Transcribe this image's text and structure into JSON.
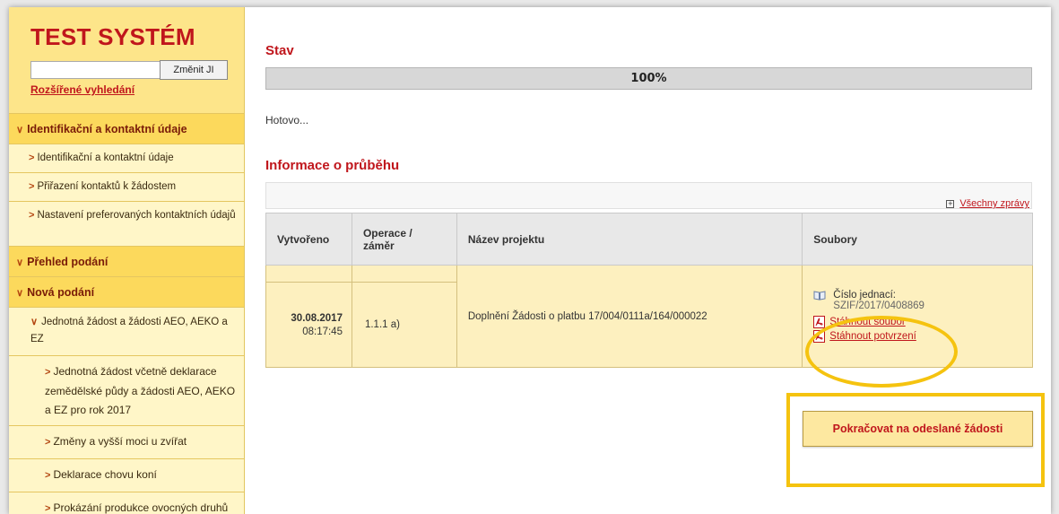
{
  "sidebar": {
    "brand": "TEST SYSTÉM",
    "search_value": "",
    "search_button": "Změnit JI",
    "advanced_search": "Rozšířené vyhledání",
    "items": [
      {
        "label": "Identifikační a kontaktní údaje",
        "kind": "head",
        "icon": "chevron-down"
      },
      {
        "label": "Identifikační a kontaktní údaje",
        "kind": "sub",
        "icon": "chevron-right"
      },
      {
        "label": "Přiřazení kontaktů k žádostem",
        "kind": "sub",
        "icon": "chevron-right"
      },
      {
        "label": "Nastavení preferovaných kontaktních údajů",
        "kind": "sub",
        "icon": "chevron-right"
      },
      {
        "label": "Přehled podání",
        "kind": "head",
        "icon": "chevron-down"
      },
      {
        "label": "Nová podání",
        "kind": "head",
        "icon": "chevron-down"
      },
      {
        "label": "Jednotná žádost a žádosti AEO, AEKO a EZ",
        "kind": "sub",
        "icon": "chevron-down"
      },
      {
        "label": "Jednotná žádost včetně deklarace zemědělské půdy a žádosti AEO, AEKO a EZ pro rok 2017",
        "kind": "sub3",
        "icon": "chevron-right"
      },
      {
        "label": "Změny a vyšší moci u zvířat",
        "kind": "sub3",
        "icon": "chevron-right"
      },
      {
        "label": "Deklarace chovu koní",
        "kind": "sub3",
        "icon": "chevron-right"
      },
      {
        "label": "Prokázání produkce ovocných druhů",
        "kind": "sub3",
        "icon": "chevron-right"
      }
    ]
  },
  "main": {
    "stav_title": "Stav",
    "progress": {
      "percent": 100,
      "label": "100%"
    },
    "status_text": "Hotovo...",
    "info_title": "Informace o průběhu",
    "all_messages": "Všechny zprávy",
    "table": {
      "headers": {
        "created": "Vytvořeno",
        "operation": "Operace / záměr",
        "project": "Název projektu",
        "files": "Soubory"
      },
      "row": {
        "date": "30.08.2017",
        "time": "08:17:45",
        "operation": "1.1.1 a)",
        "project": "Doplnění Žádosti o platbu 17/004/0111a/164/000022",
        "cj_label": "Číslo jednací:",
        "cj_value": "SZIF/2017/0408869",
        "download_file": "Stáhnout soubor",
        "download_confirmation": "Stáhnout potvrzení"
      }
    },
    "continue_button": "Pokračovat na odeslané žádosti"
  },
  "colors": {
    "accent_red": "#c0161c",
    "sidebar_bg": "#fde58a",
    "highlight_yellow": "#f5c30f"
  }
}
